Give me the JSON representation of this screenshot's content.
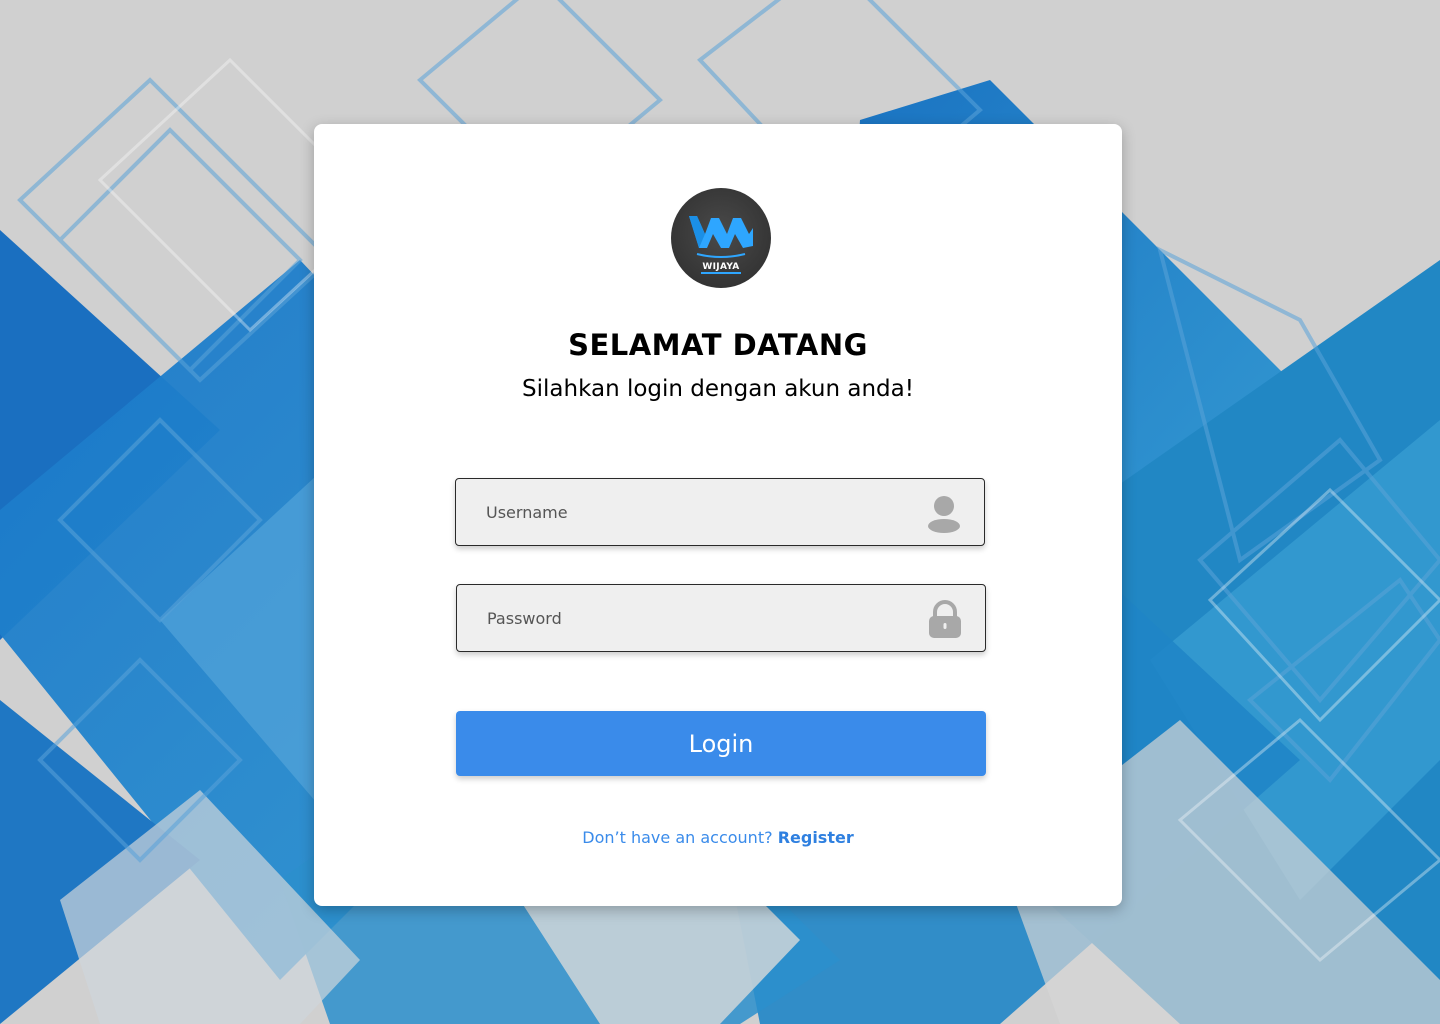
{
  "brand": {
    "logo_text": "WIJAYA",
    "logo_bg": "#353535",
    "logo_accent": "#2ea6ff"
  },
  "header": {
    "title": "SELAMAT DATANG",
    "subtitle": "Silahkan login dengan akun anda!"
  },
  "form": {
    "username": {
      "placeholder": "Username",
      "value": "",
      "icon": "user-icon"
    },
    "password": {
      "placeholder": "Password",
      "value": "",
      "icon": "lock-icon"
    },
    "login_label": "Login"
  },
  "footer": {
    "prompt": "Don’t have an account?",
    "register_label": "Register"
  },
  "colors": {
    "accent": "#3a8bea",
    "background": "#cfcfcf",
    "card": "#ffffff",
    "field": "#efefef"
  }
}
